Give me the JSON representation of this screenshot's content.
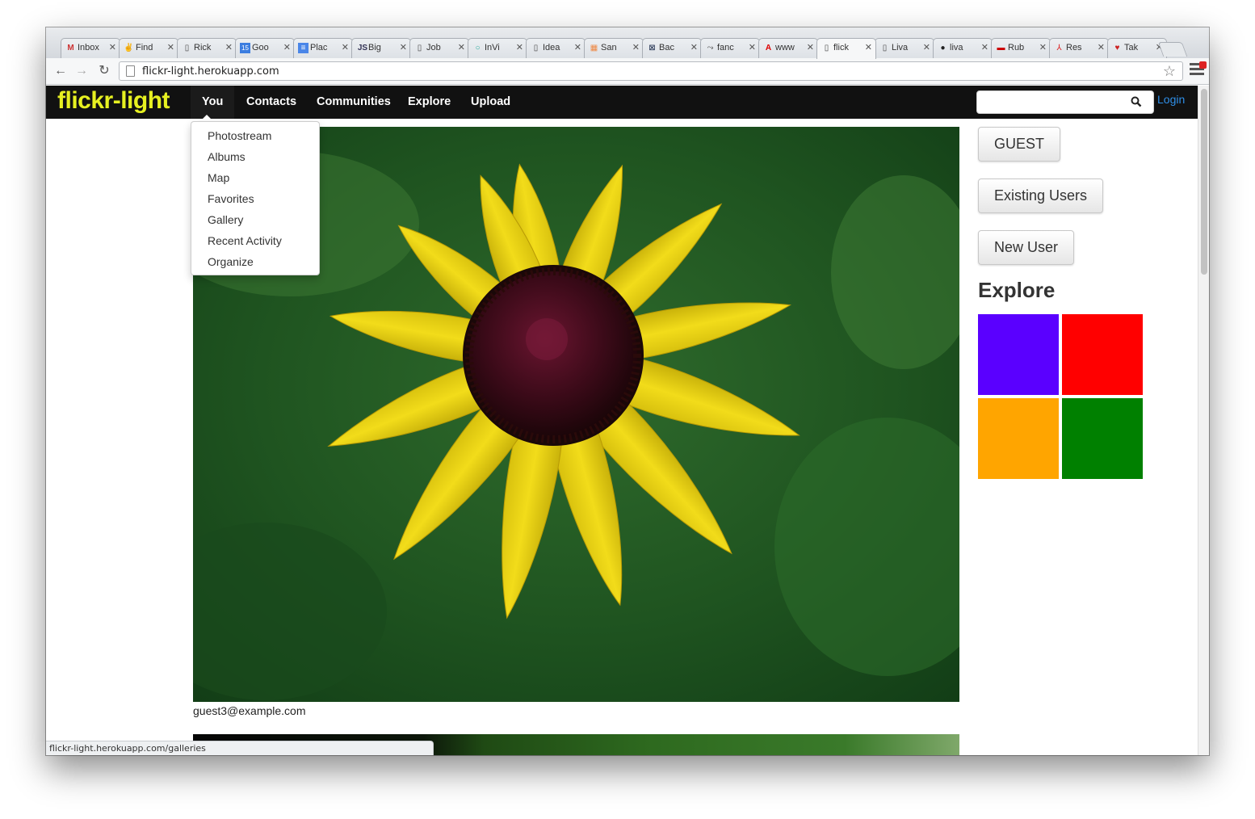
{
  "browser": {
    "tabs": [
      {
        "label": "Inbox",
        "icon": "gmail-icon",
        "glyph": "M"
      },
      {
        "label": "Find",
        "icon": "peace-icon",
        "glyph": "✌"
      },
      {
        "label": "Rick",
        "icon": "page-icon",
        "glyph": "▯"
      },
      {
        "label": "Goo",
        "icon": "calendar-icon",
        "glyph": "15"
      },
      {
        "label": "Plac",
        "icon": "docs-icon",
        "glyph": "≡"
      },
      {
        "label": "Big",
        "icon": "js-icon",
        "glyph": "JS"
      },
      {
        "label": "Job",
        "icon": "page-icon",
        "glyph": "▯"
      },
      {
        "label": "InVi",
        "icon": "circle-icon",
        "glyph": "○"
      },
      {
        "label": "Idea",
        "icon": "page-icon",
        "glyph": "▯"
      },
      {
        "label": "San",
        "icon": "windows-icon",
        "glyph": "▦"
      },
      {
        "label": "Bac",
        "icon": "logo-icon",
        "glyph": "⊠"
      },
      {
        "label": "fanc",
        "icon": "feather-icon",
        "glyph": "⤳"
      },
      {
        "label": "www",
        "icon": "adobe-icon",
        "glyph": "A"
      },
      {
        "label": "flick",
        "icon": "page-icon",
        "glyph": "▯"
      },
      {
        "label": "Liva",
        "icon": "page-icon",
        "glyph": "▯"
      },
      {
        "label": "liva",
        "icon": "github-icon",
        "glyph": "●"
      },
      {
        "label": "Rub",
        "icon": "ruby-icon",
        "glyph": "▬"
      },
      {
        "label": "Res",
        "icon": "pdf-icon",
        "glyph": "⅄"
      },
      {
        "label": "Tak",
        "icon": "apple-icon",
        "glyph": "♥"
      }
    ],
    "active_tab_index": 13,
    "url": "flickr-light.herokuapp.com",
    "status_text": "flickr-light.herokuapp.com/galleries"
  },
  "navbar": {
    "brand": "flickr-light",
    "items": [
      "You",
      "Contacts",
      "Communities",
      "Explore",
      "Upload"
    ],
    "search_value": "",
    "login": "Login"
  },
  "dropdown": {
    "items": [
      "Photostream",
      "Albums",
      "Map",
      "Favorites",
      "Gallery",
      "Recent Activity",
      "Organize"
    ]
  },
  "main": {
    "caption": "guest3@example.com"
  },
  "sidebar": {
    "buttons": [
      "GUEST",
      "Existing Users",
      "New User"
    ],
    "explore_heading": "Explore",
    "tiles": [
      "#5a00ff",
      "#ff0000",
      "#ffa500",
      "#008000"
    ]
  },
  "colors": {
    "brand": "#e6f021",
    "navbar_bg": "#111111",
    "login_link": "#2f8fe8"
  }
}
